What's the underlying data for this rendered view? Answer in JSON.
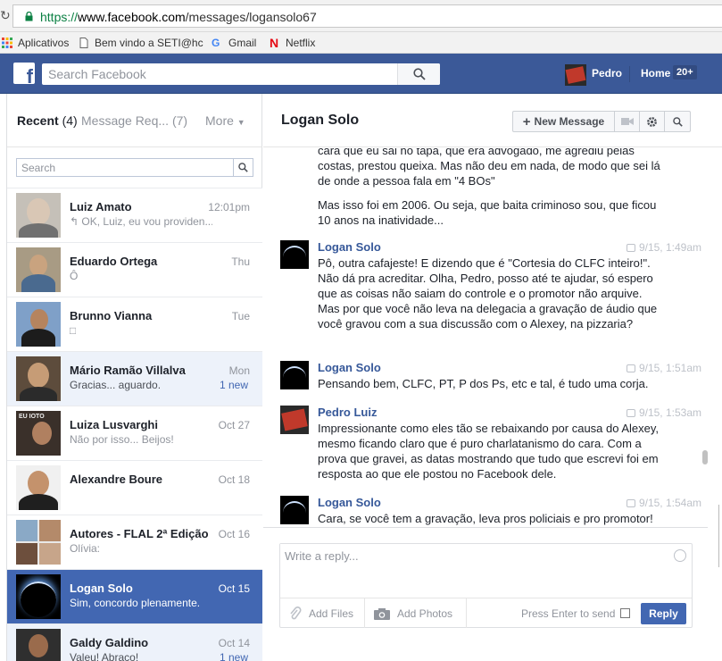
{
  "browser": {
    "url_protocol": "https://",
    "url_host": "www.facebook.com",
    "url_path": "/messages/logansolo67",
    "bookmarks": [
      {
        "label": "Aplicativos",
        "icon": "apps-grid-icon"
      },
      {
        "label": "Bem vindo a SETI@hc",
        "icon": "page-icon"
      },
      {
        "label": "Gmail",
        "icon": "google-icon"
      },
      {
        "label": "Netflix",
        "icon": "netflix-icon"
      }
    ]
  },
  "topbar": {
    "search_placeholder": "Search Facebook",
    "profile_name": "Pedro",
    "home_label": "Home",
    "home_badge": "20+"
  },
  "sidebar": {
    "tab_recent": "Recent",
    "tab_recent_count": "(4)",
    "tab_requests": "Message Req... (7)",
    "tab_more": "More",
    "search_placeholder": "Search",
    "conversations": [
      {
        "name": "Luiz Amato",
        "snippet": "↰ OK, Luiz, eu vou providen...",
        "time": "12:01pm",
        "new": "",
        "state": "read"
      },
      {
        "name": "Eduardo Ortega",
        "snippet": "Ô",
        "time": "Thu",
        "new": "",
        "state": "read"
      },
      {
        "name": "Brunno Vianna",
        "snippet": "□",
        "time": "Tue",
        "new": "",
        "state": "read"
      },
      {
        "name": "Mário Ramão Villalva",
        "snippet": "Gracias... aguardo.",
        "time": "Mon",
        "new": "1 new",
        "state": "unread"
      },
      {
        "name": "Luiza Lusvarghi",
        "snippet": "Não por isso... Beijos!",
        "time": "Oct 27",
        "new": "",
        "state": "read"
      },
      {
        "name": "Alexandre Boure",
        "snippet": "",
        "time": "Oct 18",
        "new": "",
        "state": "read"
      },
      {
        "name": "Autores - FLAL 2ª Edição",
        "snippet": "Olívia:",
        "time": "Oct 16",
        "new": "",
        "state": "read"
      },
      {
        "name": "Logan Solo",
        "snippet": "Sim, concordo plenamente.",
        "time": "Oct 15",
        "new": "",
        "state": "active"
      },
      {
        "name": "Galdy Galdino",
        "snippet": "Valeu! Abraço!",
        "time": "Oct 14",
        "new": "1 new",
        "state": "unread"
      }
    ]
  },
  "chat": {
    "title": "Logan Solo",
    "new_message_label": "New Message",
    "messages_top": {
      "text1": "cara que eu sai no tapa, que era advogado, me agrediu pelas costas, prestou queixa. Mas não deu em nada, de modo que sei lá de onde a pessoa fala em \"4 BOs\"",
      "text2": "Mas isso foi em 2006. Ou seja, que baita criminoso sou, que ficou 10 anos na inatividade..."
    },
    "messages": [
      {
        "author": "Logan Solo",
        "time": "9/15, 1:49am",
        "text": "Pô, outra cafajeste! E dizendo que é \"Cortesia do CLFC inteiro!\". Não dá pra acreditar. Olha, Pedro, posso até te ajudar, só espero que as coisas não saiam do controle e o promotor não arquive. Mas por que você não leva na delegacia a gravação de áudio que você gravou com a sua discussão com o Alexey, na pizzaria?"
      },
      {
        "author": "Logan Solo",
        "time": "9/15, 1:51am",
        "text": "Pensando bem, CLFC, PT, P dos Ps, etc e tal, é tudo uma corja."
      },
      {
        "author": "Pedro Luiz",
        "time": "9/15, 1:53am",
        "text": "Impressionante como eles tão se rebaixando por causa do Alexey, mesmo ficando claro que é puro charlatanismo do cara. Com a prova que gravei, as datas mostrando que tudo que escrevi foi em resposta ao que ele postou no Facebook dele."
      },
      {
        "author": "Logan Solo",
        "time": "9/15, 1:54am",
        "text": "Cara, se você tem a gravação, leva pros policiais e pro promotor!"
      }
    ],
    "composer": {
      "placeholder": "Write a reply...",
      "add_files": "Add Files",
      "add_photos": "Add Photos",
      "press_enter": "Press Enter to send",
      "reply_label": "Reply"
    }
  },
  "colors": {
    "facebook_blue": "#3b5998",
    "active_row": "#4267b2",
    "unread_row": "#edf2fa",
    "link_blue": "#365899"
  }
}
